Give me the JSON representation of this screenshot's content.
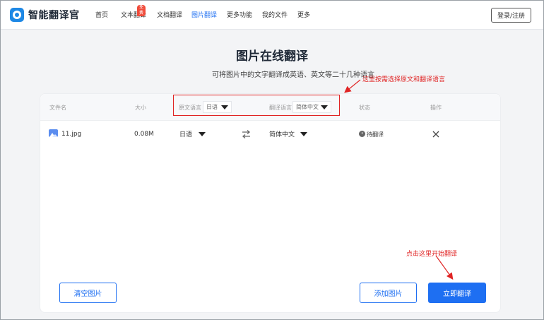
{
  "app": {
    "name": "智能翻译官"
  },
  "nav": {
    "items": [
      {
        "label": "首页"
      },
      {
        "label": "文本翻译",
        "badge": "免费"
      },
      {
        "label": "文档翻译"
      },
      {
        "label": "图片翻译"
      },
      {
        "label": "更多功能"
      },
      {
        "label": "我的文件"
      },
      {
        "label": "更多"
      }
    ],
    "login": "登录/注册"
  },
  "page": {
    "title": "图片在线翻译",
    "subtitle": "可将图片中的文字翻译成英语、英文等二十几种语言"
  },
  "table": {
    "headers": {
      "filename": "文件名",
      "size": "大小",
      "source_lang_label": "原文语言",
      "source_lang_value": "日语",
      "target_lang_label": "翻译语言",
      "target_lang_value": "简体中文",
      "status": "状态",
      "action": "操作"
    },
    "rows": [
      {
        "filename": "11.jpg",
        "size": "0.08M",
        "source": "日语",
        "target": "简体中文",
        "status": "待翻译"
      }
    ]
  },
  "buttons": {
    "clear": "清空图片",
    "add": "添加图片",
    "translate": "立即翻译"
  },
  "annotations": {
    "lang_note": "这里按需选择原文和翻译语言",
    "start_note": "点击这里开始翻译"
  },
  "colors": {
    "accent": "#1e6ff2",
    "annotation": "#e02424",
    "badge": "#f04b3a"
  }
}
